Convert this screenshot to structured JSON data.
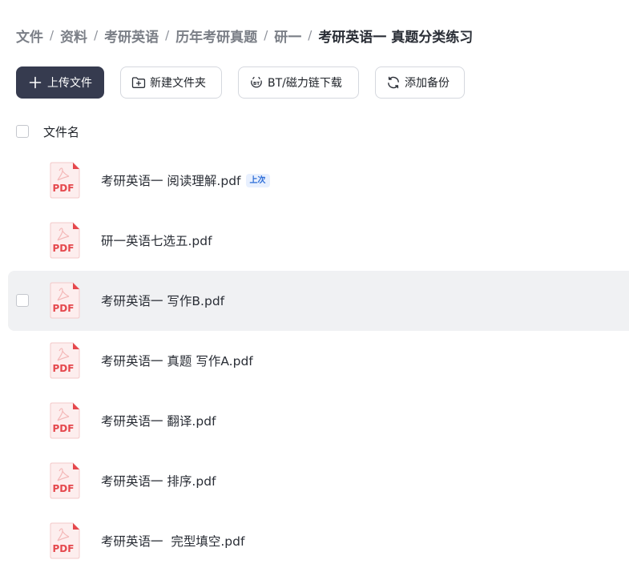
{
  "breadcrumb": {
    "items": [
      "文件",
      "资料",
      "考研英语",
      "历年考研真题",
      "研一"
    ],
    "separator": "/",
    "current": "考研英语一 真题分类练习"
  },
  "toolbar": {
    "upload_label": "上传文件",
    "new_folder_label": "新建文件夹",
    "bt_label": "BT/磁力链下载",
    "backup_label": "添加备份"
  },
  "list": {
    "header_label": "文件名",
    "files": [
      {
        "name": "考研英语一 阅读理解.pdf",
        "badge": "上次",
        "icon": "pdf-icon"
      },
      {
        "name": "研一英语七选五.pdf",
        "badge": "",
        "icon": "pdf-icon"
      },
      {
        "name": "考研英语一 写作B.pdf",
        "badge": "",
        "icon": "pdf-icon"
      },
      {
        "name": "考研英语一 真题 写作A.pdf",
        "badge": "",
        "icon": "pdf-icon"
      },
      {
        "name": "考研英语一 翻译.pdf",
        "badge": "",
        "icon": "pdf-icon"
      },
      {
        "name": "考研英语一 排序.pdf",
        "badge": "",
        "icon": "pdf-icon"
      },
      {
        "name": "考研英语一  完型填空.pdf",
        "badge": "",
        "icon": "pdf-icon"
      }
    ],
    "pdf_icon_text": "PDF"
  },
  "colors": {
    "primary_button": "#363b4f",
    "hover_row": "#f0f1f3",
    "pdf_red": "#e5484d",
    "badge_blue": "#2f6fd8"
  }
}
